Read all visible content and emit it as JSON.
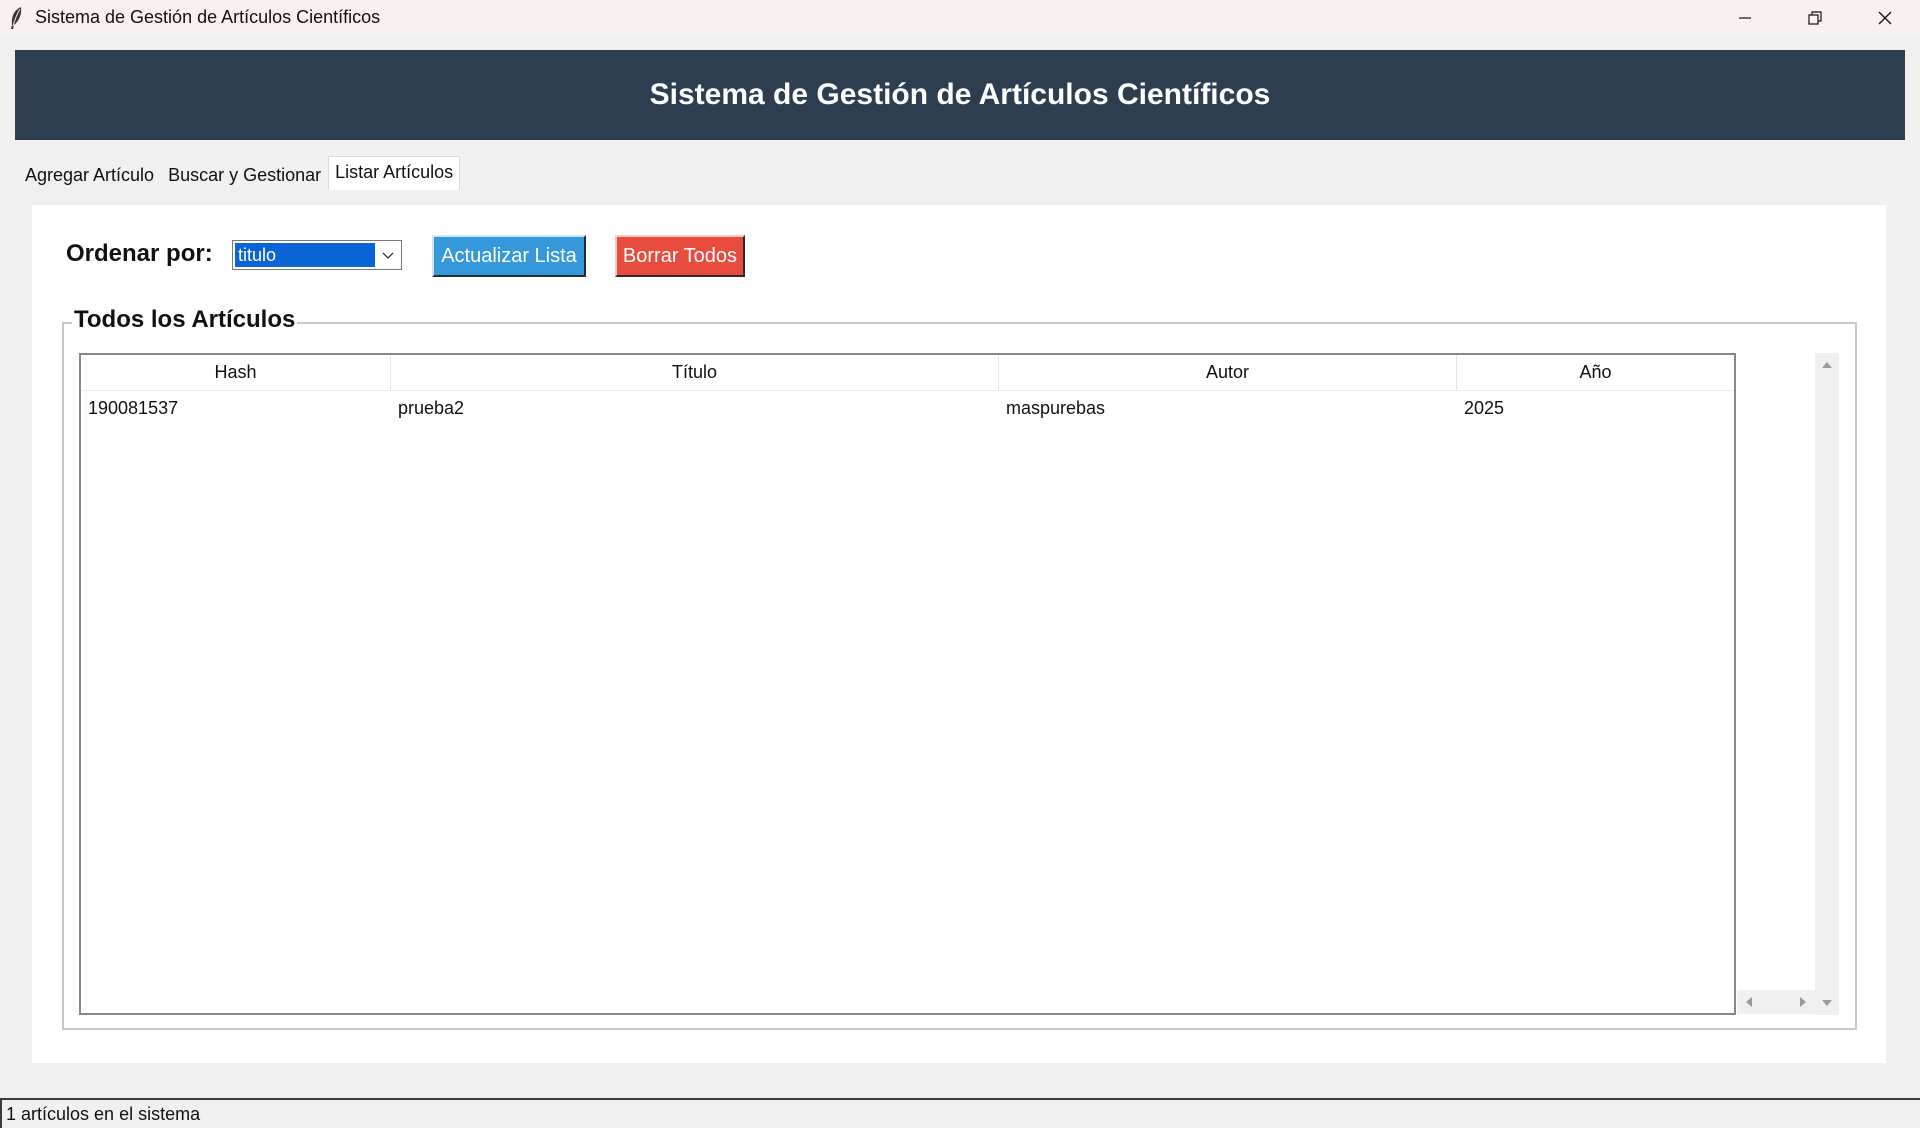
{
  "window": {
    "title": "Sistema de Gestión de Artículos Científicos",
    "icon": "feather-icon"
  },
  "header": {
    "title": "Sistema de Gestión de Artículos Científicos",
    "background": "#2c3e50"
  },
  "tabs": [
    {
      "label": "Agregar Artículo",
      "active": false
    },
    {
      "label": "Buscar y Gestionar",
      "active": false
    },
    {
      "label": "Listar Artículos",
      "active": true
    }
  ],
  "controls": {
    "order_label": "Ordenar por:",
    "order_value": "titulo",
    "refresh_label": "Actualizar Lista",
    "refresh_color": "#3498db",
    "delete_all_label": "Borrar Todos",
    "delete_color": "#e74c3c"
  },
  "group": {
    "title": "Todos los Artículos"
  },
  "table": {
    "columns": [
      "Hash",
      "Título",
      "Autor",
      "Año"
    ],
    "rows": [
      [
        "190081537",
        "prueba2",
        "maspurebas",
        "2025"
      ]
    ]
  },
  "status": {
    "text": "1 artículos en el sistema"
  }
}
